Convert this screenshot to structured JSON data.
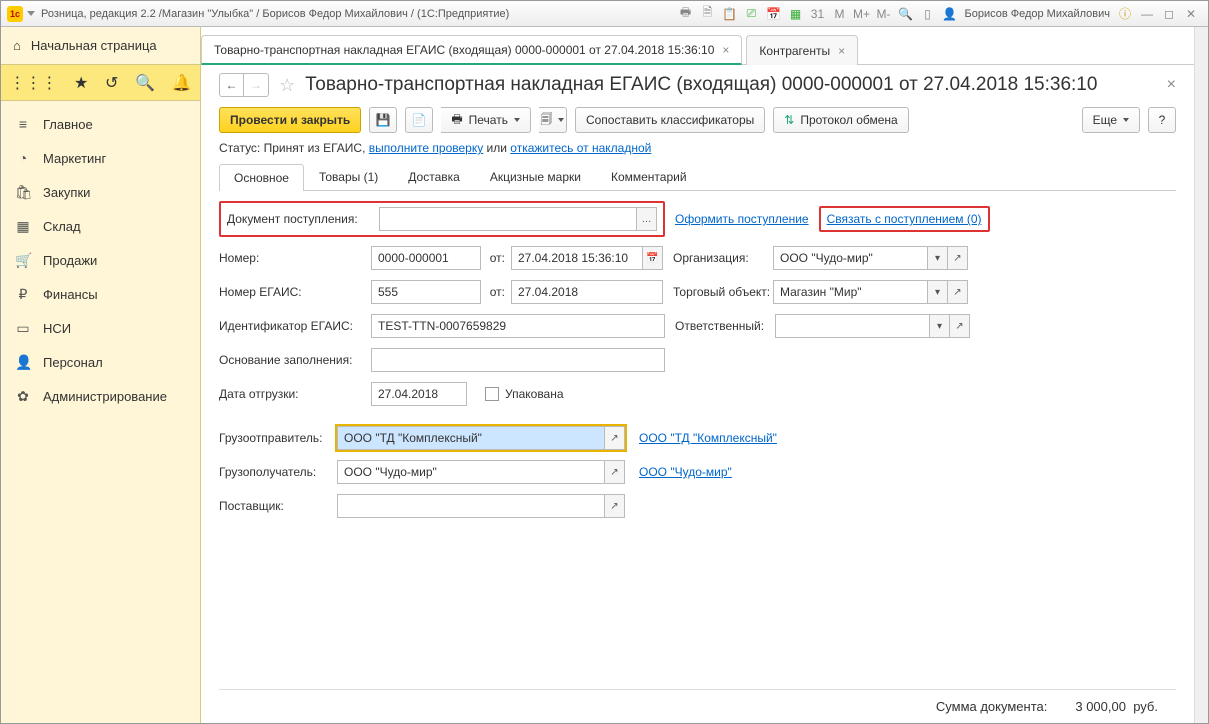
{
  "title_bar": {
    "app_title": "Розница, редакция 2.2 /Магазин \"Улыбка\" / Борисов Федор Михайлович / (1С:Предприятие)",
    "user": "Борисов Федор Михайлович",
    "m_labels": [
      "M",
      "M+",
      "M-"
    ]
  },
  "home_label": "Начальная страница",
  "nav": [
    {
      "icon": "≡",
      "label": "Главное"
    },
    {
      "icon": "◔",
      "label": "Маркетинг"
    },
    {
      "icon": "🛍",
      "label": "Закупки"
    },
    {
      "icon": "▦",
      "label": "Склад"
    },
    {
      "icon": "🛒",
      "label": "Продажи"
    },
    {
      "icon": "₽",
      "label": "Финансы"
    },
    {
      "icon": "▭",
      "label": "НСИ"
    },
    {
      "icon": "👤",
      "label": "Персонал"
    },
    {
      "icon": "✿",
      "label": "Администрирование"
    }
  ],
  "tabs": [
    {
      "label": "Товарно-транспортная накладная ЕГАИС (входящая) 0000-000001 от 27.04.2018 15:36:10",
      "active": true
    },
    {
      "label": "Контрагенты",
      "active": false
    }
  ],
  "doc_title": "Товарно-транспортная накладная ЕГАИС (входящая) 0000-000001 от 27.04.2018 15:36:10",
  "toolbar": {
    "post_close": "Провести и закрыть",
    "print": "Печать",
    "match": "Сопоставить классификаторы",
    "protocol": "Протокол обмена",
    "more": "Еще",
    "help": "?"
  },
  "status": {
    "prefix": "Статус: ",
    "text": "Принят из ЕГАИС, ",
    "link1": "выполните проверку",
    "mid": " или ",
    "link2": "откажитесь от накладной"
  },
  "inner_tabs": [
    "Основное",
    "Товары (1)",
    "Доставка",
    "Акцизные марки",
    "Комментарий"
  ],
  "form": {
    "doc_receipt_label": "Документ поступления:",
    "link_create": "Оформить поступление",
    "link_bind": "Связать с поступлением (0)",
    "number_label": "Номер:",
    "number": "0000-000001",
    "from_label": "от:",
    "datetime": "27.04.2018 15:36:10",
    "org_label": "Организация:",
    "org": "ООО \"Чудо-мир\"",
    "egais_num_label": "Номер ЕГАИС:",
    "egais_num": "555",
    "egais_date": "27.04.2018",
    "trade_obj_label": "Торговый объект:",
    "trade_obj": "Магазин \"Мир\"",
    "egais_id_label": "Идентификатор ЕГАИС:",
    "egais_id": "TEST-TTN-0007659829",
    "responsible_label": "Ответственный:",
    "basis_label": "Основание заполнения:",
    "ship_date_label": "Дата отгрузки:",
    "ship_date": "27.04.2018",
    "packed_label": "Упакована",
    "sender_label": "Грузоотправитель:",
    "sender": "ООО \"ТД \"Комплексный\"",
    "sender_link": "ООО \"ТД \"Комплексный\"",
    "receiver_label": "Грузополучатель:",
    "receiver": "ООО \"Чудо-мир\"",
    "receiver_link": "ООО \"Чудо-мир\"",
    "supplier_label": "Поставщик:"
  },
  "footer": {
    "sum_label": "Сумма документа:",
    "sum_value": "3 000,00",
    "currency": "руб."
  }
}
